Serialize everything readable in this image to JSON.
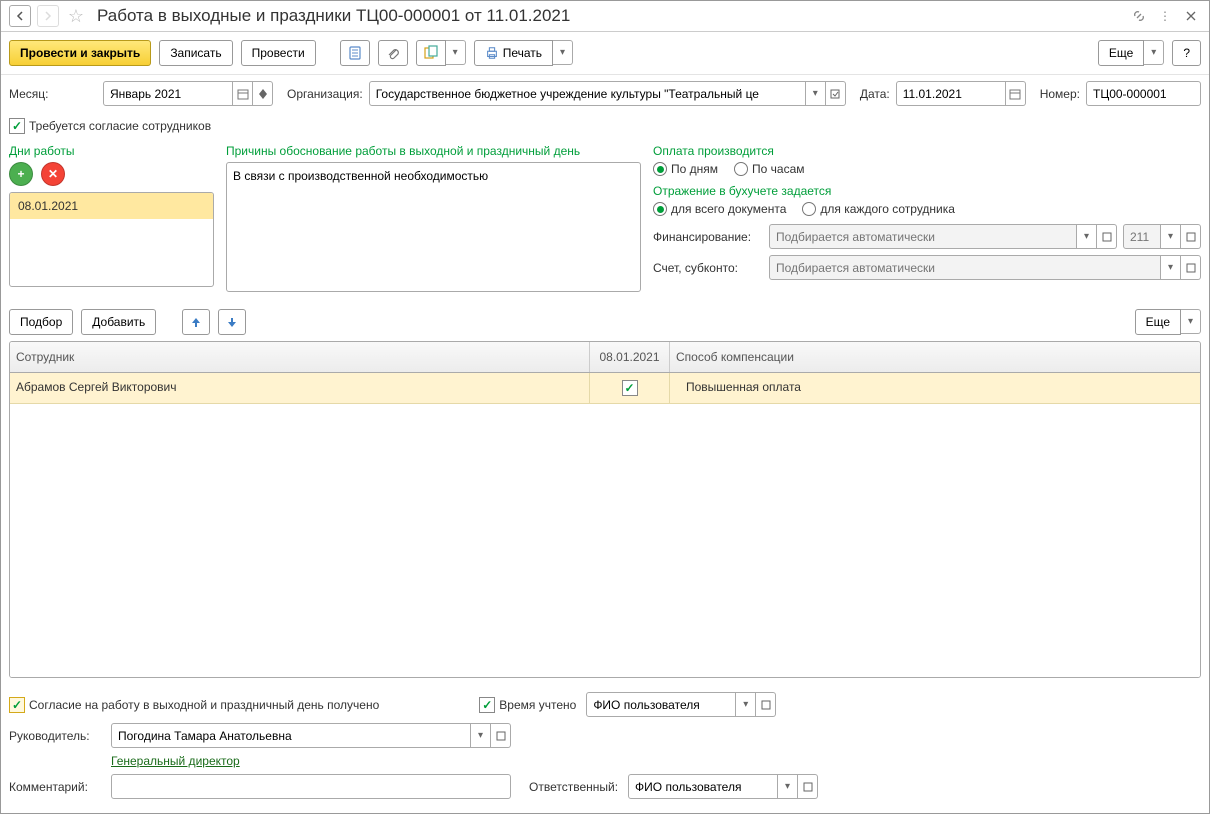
{
  "titlebar": {
    "title": "Работа в выходные и праздники ТЦ00-000001 от 11.01.2021"
  },
  "toolbar": {
    "post_close": "Провести и закрыть",
    "save": "Записать",
    "post": "Провести",
    "print": "Печать",
    "more": "Еще",
    "help": "?"
  },
  "header": {
    "month_label": "Месяц:",
    "month_value": "Январь 2021",
    "org_label": "Организация:",
    "org_value": "Государственное бюджетное учреждение культуры \"Театральный це",
    "date_label": "Дата:",
    "date_value": "11.01.2021",
    "number_label": "Номер:",
    "number_value": "ТЦ00-000001",
    "consent_required": "Требуется согласие сотрудников"
  },
  "days": {
    "label": "Дни работы",
    "items": [
      "08.01.2021"
    ]
  },
  "reason": {
    "label": "Причины обоснование работы в выходной и праздничный день",
    "text": "В связи с производственной необходимостью"
  },
  "payment": {
    "pay_label": "Оплата производится",
    "by_days": "По дням",
    "by_hours": "По часам",
    "accounting_label": "Отражение в бухучете задается",
    "whole_doc": "для всего документа",
    "per_employee": "для каждого сотрудника",
    "financing_label": "Финансирование:",
    "financing_placeholder": "Подбирается автоматически",
    "statya_value": "211",
    "account_label": "Счет, субконто:",
    "account_placeholder": "Подбирается автоматически"
  },
  "table_toolbar": {
    "select": "Подбор",
    "add": "Добавить",
    "more": "Еще"
  },
  "table": {
    "col_employee": "Сотрудник",
    "col_date": "08.01.2021",
    "col_compensation": "Способ компенсации",
    "rows": [
      {
        "employee": "Абрамов Сергей Викторович",
        "checked": true,
        "compensation": "Повышенная оплата"
      }
    ]
  },
  "footer": {
    "consent_received": "Согласие на работу в выходной и праздничный день получено",
    "time_counted": "Время учтено",
    "user_fio": "ФИО пользователя",
    "manager_label": "Руководитель:",
    "manager_value": "Погодина Тамара Анатольевна",
    "manager_position": "Генеральный директор",
    "comment_label": "Комментарий:",
    "responsible_label": "Ответственный:",
    "responsible_value": "ФИО пользователя"
  }
}
